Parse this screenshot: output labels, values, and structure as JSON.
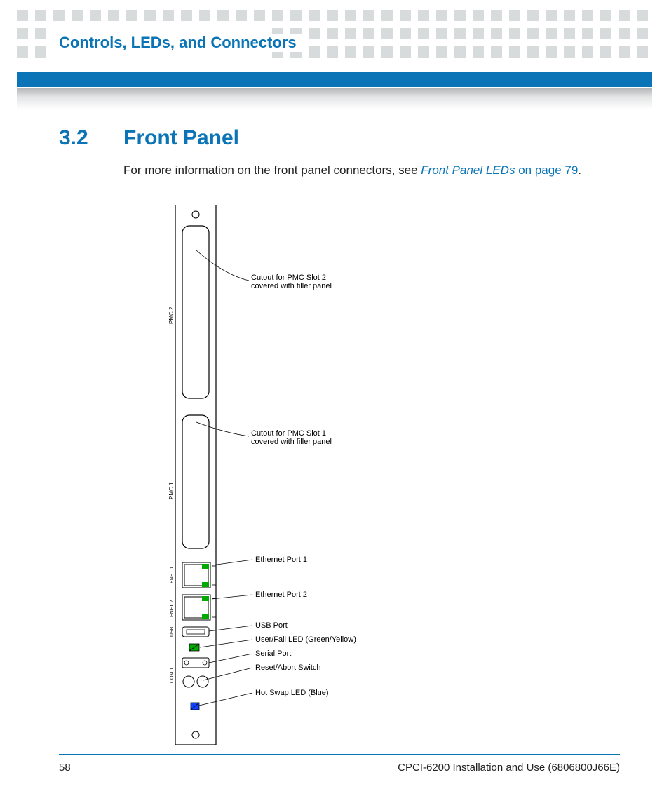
{
  "header": {
    "chapter_title": "Controls, LEDs, and Connectors"
  },
  "section": {
    "number": "3.2",
    "title": "Front Panel",
    "intro_prefix": "For more information on the front panel connectors, see ",
    "intro_link": "Front Panel LEDs",
    "intro_link_suffix": " on page 79",
    "intro_terminator": "."
  },
  "diagram": {
    "slot_labels": {
      "pmc2": "PMC 2",
      "pmc1": "PMC 1",
      "enet1": "ENET 1",
      "enet2": "ENET 2",
      "usb": "USB",
      "com1": "COM 1"
    },
    "callouts": {
      "pmc_slot2_line1": "Cutout  for PMC Slot 2",
      "pmc_slot2_line2": "covered with filler panel",
      "pmc_slot1_line1": "Cutout  for PMC Slot 1",
      "pmc_slot1_line2": "covered with filler panel",
      "enet1": "Ethernet Port 1",
      "enet2": "Ethernet Port 2",
      "usb": "USB Port",
      "userfail": "User/Fail LED (Green/Yellow)",
      "serial": "Serial Port",
      "reset": "Reset/Abort Switch",
      "hotswap": "Hot Swap LED (Blue)"
    }
  },
  "footer": {
    "page_number": "58",
    "doc_title": "CPCI-6200 Installation and Use (6806800J66E)"
  }
}
